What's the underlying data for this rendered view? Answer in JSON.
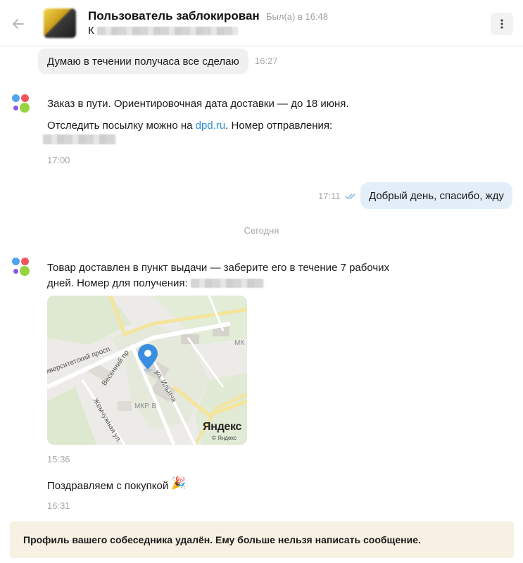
{
  "header": {
    "name": "Пользователь заблокирован",
    "status": "Был(а) в 16:48",
    "subtitle": "К"
  },
  "messages": {
    "m1": {
      "text": "Думаю в течении получаса все сделаю",
      "time": "16:27"
    },
    "m2": {
      "line1": "Заказ в пути. Ориентировочная дата доставки — до 18 июня.",
      "line2_prefix": "Отследить посылку можно на ",
      "link": "dpd.ru",
      "line2_suffix": ". Номер отправления:",
      "time": "17:00"
    },
    "m3": {
      "text": "Добрый день, спасибо, жду",
      "time": "17:11"
    },
    "date_separator": "Сегодня",
    "m4": {
      "line1": "Товар доставлен в пункт выдачи — заберите его в течение 7 рабочих",
      "line2": "дней. Номер для получения:",
      "time": "15:36"
    },
    "m5": {
      "text": "Поздравляем с покупкой",
      "time": "16:31"
    }
  },
  "map": {
    "street_1": "иверситетский просп.",
    "street_2": "Весенний пр",
    "street_3": "ул. Ильича",
    "street_4": "Жемчужная ул.",
    "district": "МКР. В",
    "district_2": "МК",
    "brand": "Яндекс",
    "brand_copy": "© Яндекс"
  },
  "notice": "Профиль вашего собеседника удалён. Ему больше нельзя написать сообщение.",
  "colors": {
    "link": "#2e8fd7",
    "outgoing_bubble": "#e3eef8",
    "incoming_bubble": "#f0f0f0",
    "read_ticks": "#7fb3de",
    "notice_bg": "#f6f1e3",
    "pin": "#3a8ee0"
  }
}
